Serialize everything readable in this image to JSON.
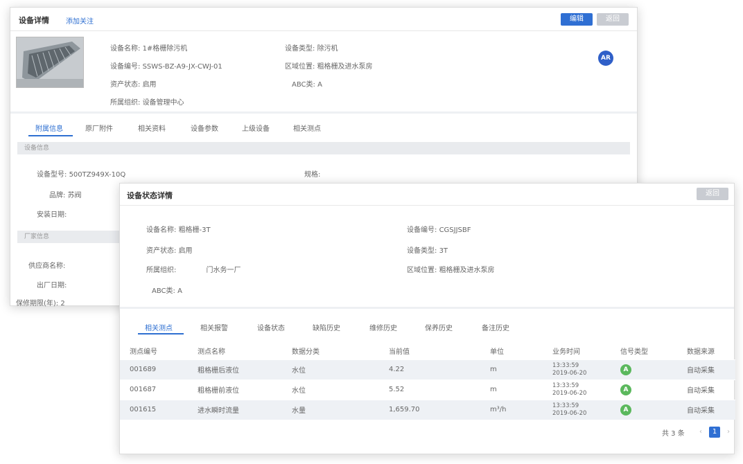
{
  "back_window": {
    "title": "设备详情",
    "follow_link": "添加关注",
    "edit_button": "编辑",
    "back_button": "返回",
    "ar_badge": "AR",
    "info": {
      "name_label": "设备名称:",
      "name_value": "1#格栅除污机",
      "code_label": "设备编号:",
      "code_value": "SSWS-BZ-A9-JX-CWJ-01",
      "asset_label": "资产状态:",
      "asset_value": "启用",
      "org_label": "所属组织:",
      "org_value": "设备管理中心",
      "type_label": "设备类型:",
      "type_value": "除污机",
      "area_label": "区域位置:",
      "area_value": "粗格栅及进水泵房",
      "abc_label": "ABC类:",
      "abc_value": "A"
    },
    "tabs": [
      "附属信息",
      "原厂附件",
      "相关资料",
      "设备参数",
      "上级设备",
      "相关测点"
    ],
    "section1": "设备信息",
    "model_label": "设备型号:",
    "model_value": "500TZ949X-10Q",
    "spec_label": "规格:",
    "brand_label": "品牌:",
    "brand_value": "苏阀",
    "install_label": "安装日期:",
    "section2": "厂家信息",
    "supplier_label": "供应商名称:",
    "factory_label": "出厂日期:",
    "warranty_label": "保修期限(年):",
    "warranty_value": "2"
  },
  "front_window": {
    "title": "设备状态详情",
    "back_button": "返回",
    "info": {
      "name_label": "设备名称:",
      "name_value": "粗格栅-3T",
      "asset_label": "资产状态:",
      "asset_value": "启用",
      "org_label": "所属组织:",
      "org_value": "　　　　门水务一厂",
      "abc_label": "ABC类:",
      "abc_value": "A",
      "code_label": "设备编号:",
      "code_value": "CGSJJSBF",
      "type_label": "设备类型:",
      "type_value": "3T",
      "area_label": "区域位置:",
      "area_value": "粗格栅及进水泵房"
    },
    "tabs": [
      "相关测点",
      "相关报警",
      "设备状态",
      "缺陷历史",
      "维修历史",
      "保养历史",
      "备注历史"
    ],
    "table": {
      "headers": [
        "测点编号",
        "测点名称",
        "数据分类",
        "当前值",
        "单位",
        "业务时间",
        "信号类型",
        "数据来源"
      ],
      "rows": [
        {
          "id": "001689",
          "name": "粗格栅后液位",
          "category": "水位",
          "value": "4.22",
          "unit": "m",
          "time": "13:33:59",
          "date": "2019-06-20",
          "signal": "A",
          "source": "自动采集"
        },
        {
          "id": "001687",
          "name": "粗格栅前液位",
          "category": "水位",
          "value": "5.52",
          "unit": "m",
          "time": "13:33:59",
          "date": "2019-06-20",
          "signal": "A",
          "source": "自动采集"
        },
        {
          "id": "001615",
          "name": "进水瞬时流量",
          "category": "水量",
          "value": "1,659.70",
          "unit": "m³/h",
          "time": "13:33:59",
          "date": "2019-06-20",
          "signal": "A",
          "source": "自动采集"
        }
      ]
    },
    "pager": {
      "total": "共 3 条",
      "prev": "‹",
      "page": "1",
      "next": "›"
    }
  },
  "colors": {
    "accent": "#2f6fd3",
    "signal_green": "#5bb85d",
    "row_stripe": "#eef1f5"
  }
}
